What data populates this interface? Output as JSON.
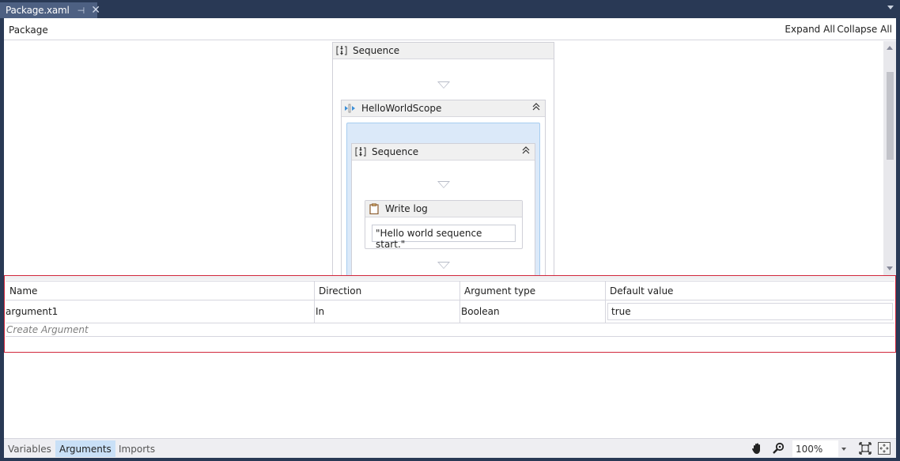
{
  "tab": {
    "title": "Package.xaml",
    "pin_icon": "pin-icon",
    "close_icon": "close-icon"
  },
  "header": {
    "breadcrumb": "Package",
    "expand_all": "Expand All",
    "collapse_all": "Collapse All"
  },
  "designer": {
    "outer_sequence": {
      "title": "Sequence",
      "icon": "sequence-icon"
    },
    "scope": {
      "title": "HelloWorldScope",
      "icon": "scope-icon",
      "collapse_glyph": "»"
    },
    "inner_sequence": {
      "title": "Sequence",
      "icon": "sequence-icon"
    },
    "write_log": {
      "title": "Write log",
      "icon": "clipboard-icon",
      "message": "\"Hello world sequence start.\""
    }
  },
  "arguments": {
    "columns": [
      "Name",
      "Direction",
      "Argument type",
      "Default value"
    ],
    "rows": [
      {
        "name": "argument1",
        "direction": "In",
        "type": "Boolean",
        "default": "true"
      }
    ],
    "create_label": "Create Argument"
  },
  "bottom_bar": {
    "tabs": [
      {
        "label": "Variables",
        "active": false
      },
      {
        "label": "Arguments",
        "active": true
      },
      {
        "label": "Imports",
        "active": false
      }
    ],
    "zoom_level": "100%",
    "icons": [
      "hand-pan-icon",
      "zoom-magnifier-icon",
      "fit-to-screen-icon",
      "overview-icon"
    ]
  },
  "colors": {
    "chrome": "#293955",
    "active_tab": "#4d6082",
    "highlight_border": "#d1283c",
    "scope_fill": "#dbe9f9",
    "active_bottom_tab": "#c9e0f7"
  }
}
